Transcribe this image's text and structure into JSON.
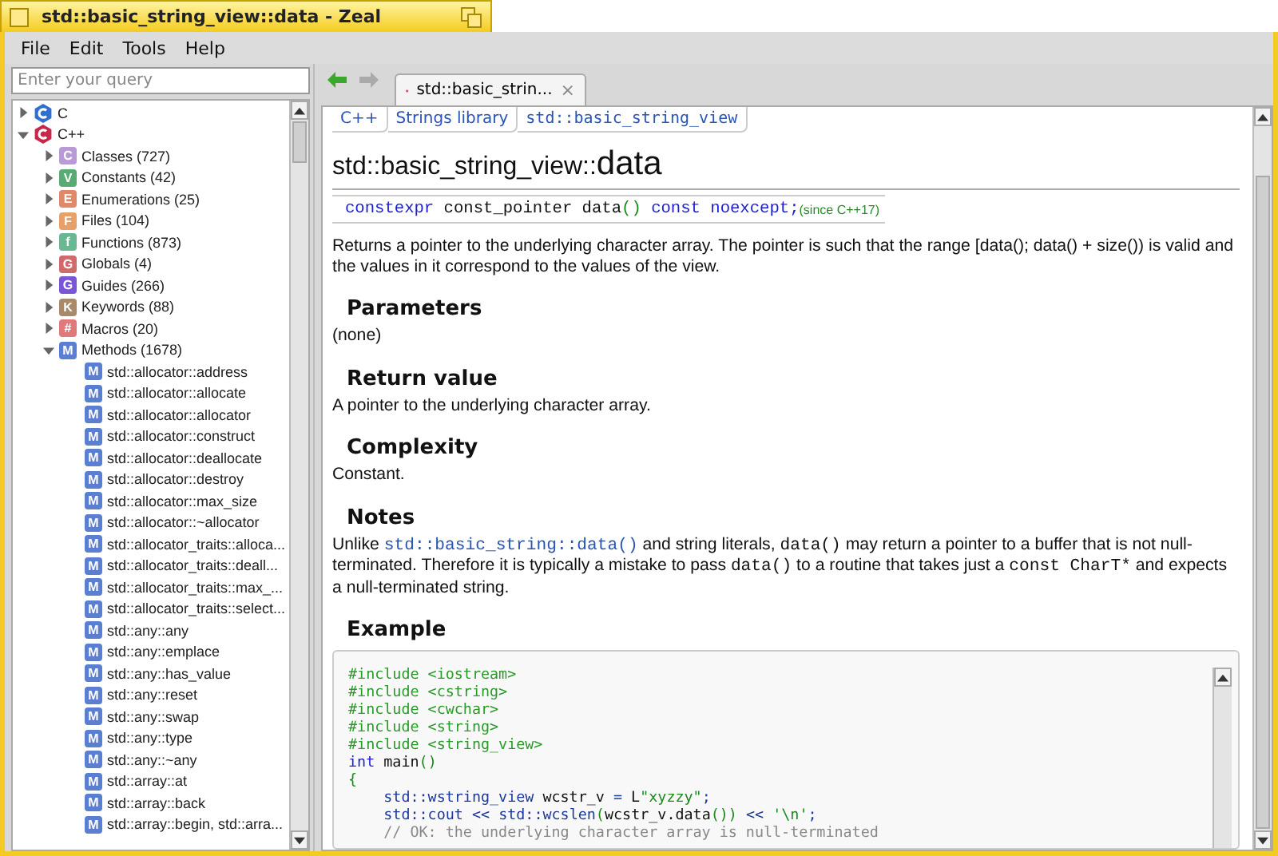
{
  "window": {
    "title": "std::basic_string_view::data - Zeal"
  },
  "menu": [
    "File",
    "Edit",
    "Tools",
    "Help"
  ],
  "search": {
    "placeholder": "Enter your query"
  },
  "tree": [
    {
      "label": "C",
      "color": "#2f6fd0",
      "expanded": false
    },
    {
      "label": "C++",
      "color": "#c8274a",
      "expanded": true,
      "children": [
        {
          "label": "Classes (727)",
          "badge": "C",
          "color": "#b79ad6",
          "expanded": false
        },
        {
          "label": "Constants (42)",
          "badge": "V",
          "color": "#5aaa73",
          "expanded": false
        },
        {
          "label": "Enumerations (25)",
          "badge": "E",
          "color": "#e0896a",
          "expanded": false
        },
        {
          "label": "Files (104)",
          "badge": "F",
          "color": "#e8a06a",
          "expanded": false
        },
        {
          "label": "Functions (873)",
          "badge": "f",
          "color": "#6ab892",
          "expanded": false
        },
        {
          "label": "Globals (4)",
          "badge": "G",
          "color": "#cf6b6b",
          "expanded": false
        },
        {
          "label": "Guides (266)",
          "badge": "G",
          "color": "#7a55d6",
          "expanded": false
        },
        {
          "label": "Keywords (88)",
          "badge": "K",
          "color": "#a88a6a",
          "expanded": false
        },
        {
          "label": "Macros (20)",
          "badge": "#",
          "color": "#e07a7a",
          "expanded": false
        },
        {
          "label": "Methods (1678)",
          "badge": "M",
          "color": "#5b7fd0",
          "expanded": true,
          "children": [
            {
              "label": "std::allocator::address",
              "badge": "M",
              "color": "#5b7fd0"
            },
            {
              "label": "std::allocator::allocate",
              "badge": "M",
              "color": "#5b7fd0"
            },
            {
              "label": "std::allocator::allocator",
              "badge": "M",
              "color": "#5b7fd0"
            },
            {
              "label": "std::allocator::construct",
              "badge": "M",
              "color": "#5b7fd0"
            },
            {
              "label": "std::allocator::deallocate",
              "badge": "M",
              "color": "#5b7fd0"
            },
            {
              "label": "std::allocator::destroy",
              "badge": "M",
              "color": "#5b7fd0"
            },
            {
              "label": "std::allocator::max_size",
              "badge": "M",
              "color": "#5b7fd0"
            },
            {
              "label": "std::allocator::~allocator",
              "badge": "M",
              "color": "#5b7fd0"
            },
            {
              "label": "std::allocator_traits::alloca...",
              "badge": "M",
              "color": "#5b7fd0"
            },
            {
              "label": "std::allocator_traits::deall...",
              "badge": "M",
              "color": "#5b7fd0"
            },
            {
              "label": "std::allocator_traits::max_...",
              "badge": "M",
              "color": "#5b7fd0"
            },
            {
              "label": "std::allocator_traits::select...",
              "badge": "M",
              "color": "#5b7fd0"
            },
            {
              "label": "std::any::any",
              "badge": "M",
              "color": "#5b7fd0"
            },
            {
              "label": "std::any::emplace",
              "badge": "M",
              "color": "#5b7fd0"
            },
            {
              "label": "std::any::has_value",
              "badge": "M",
              "color": "#5b7fd0"
            },
            {
              "label": "std::any::reset",
              "badge": "M",
              "color": "#5b7fd0"
            },
            {
              "label": "std::any::swap",
              "badge": "M",
              "color": "#5b7fd0"
            },
            {
              "label": "std::any::type",
              "badge": "M",
              "color": "#5b7fd0"
            },
            {
              "label": "std::any::~any",
              "badge": "M",
              "color": "#5b7fd0"
            },
            {
              "label": "std::array::at",
              "badge": "M",
              "color": "#5b7fd0"
            },
            {
              "label": "std::array::back",
              "badge": "M",
              "color": "#5b7fd0"
            },
            {
              "label": "std::array::begin, std::arra...",
              "badge": "M",
              "color": "#5b7fd0"
            }
          ]
        }
      ]
    }
  ],
  "tabs": [
    {
      "label": "std::basic_strin...",
      "close": "×",
      "selected": true
    }
  ],
  "breadcrumbs": [
    "C++",
    "Strings library",
    "std::basic_string_view"
  ],
  "heading": {
    "prefix": "std::basic_string_view::",
    "name": "data"
  },
  "signature": {
    "code": [
      {
        "kind": "keyword",
        "text": "constexpr"
      },
      {
        "kind": "plain",
        "text": " const_pointer data"
      },
      {
        "kind": "paren",
        "text": "()"
      },
      {
        "kind": "keyword",
        "text": " const noexcept;"
      }
    ],
    "note": "(since C++17)"
  },
  "description": "Returns a pointer to the underlying character array. The pointer is such that the range [data(); data() + size()) is valid and the values in it correspond to the values of the view.",
  "sections": [
    {
      "title": "Parameters",
      "body": [
        {
          "kind": "text",
          "text": "(none)"
        }
      ]
    },
    {
      "title": "Return value",
      "body": [
        {
          "kind": "text",
          "text": "A pointer to the underlying character array."
        }
      ]
    },
    {
      "title": "Complexity",
      "body": [
        {
          "kind": "text",
          "text": "Constant."
        }
      ]
    },
    {
      "title": "Notes",
      "body": [
        {
          "kind": "text",
          "text": "Unlike "
        },
        {
          "kind": "link",
          "text": "std::basic_string::data()"
        },
        {
          "kind": "text",
          "text": " and string literals, "
        },
        {
          "kind": "code",
          "text": "data()"
        },
        {
          "kind": "text",
          "text": " may return a pointer to a buffer that is not null-terminated. Therefore it is typically a mistake to pass "
        },
        {
          "kind": "code",
          "text": "data()"
        },
        {
          "kind": "text",
          "text": " to a routine that takes just a "
        },
        {
          "kind": "code",
          "text": "const CharT*"
        },
        {
          "kind": "text",
          "text": " and expects a null-terminated string."
        }
      ]
    }
  ],
  "example": {
    "title": "Example",
    "lines": [
      [
        {
          "kind": "include",
          "text": "#include <iostream>"
        }
      ],
      [
        {
          "kind": "include",
          "text": "#include <cstring>"
        }
      ],
      [
        {
          "kind": "include",
          "text": "#include <cwchar>"
        }
      ],
      [
        {
          "kind": "include",
          "text": "#include <string>"
        }
      ],
      [
        {
          "kind": "include",
          "text": "#include <string_view>"
        }
      ],
      [
        {
          "kind": "keyword",
          "text": "int"
        },
        {
          "kind": "plain",
          "text": " main"
        },
        {
          "kind": "paren",
          "text": "()"
        }
      ],
      [
        {
          "kind": "paren",
          "text": "{"
        }
      ],
      [
        {
          "kind": "type",
          "text": "    std::wstring_view"
        },
        {
          "kind": "plain",
          "text": " wcstr_v "
        },
        {
          "kind": "op",
          "text": "="
        },
        {
          "kind": "plain",
          "text": " L"
        },
        {
          "kind": "string",
          "text": "\"xyzzy\""
        },
        {
          "kind": "op",
          "text": ";"
        }
      ],
      [
        {
          "kind": "type",
          "text": "    std::cout"
        },
        {
          "kind": "op",
          "text": " << "
        },
        {
          "kind": "type",
          "text": "std::wcslen"
        },
        {
          "kind": "paren",
          "text": "("
        },
        {
          "kind": "plain",
          "text": "wcstr_v.data"
        },
        {
          "kind": "paren",
          "text": "())"
        },
        {
          "kind": "op",
          "text": " << "
        },
        {
          "kind": "string",
          "text": "'\\n'"
        },
        {
          "kind": "op",
          "text": ";"
        }
      ],
      [
        {
          "kind": "comment",
          "text": "    // OK: the underlying character array is null-terminated"
        }
      ]
    ]
  }
}
